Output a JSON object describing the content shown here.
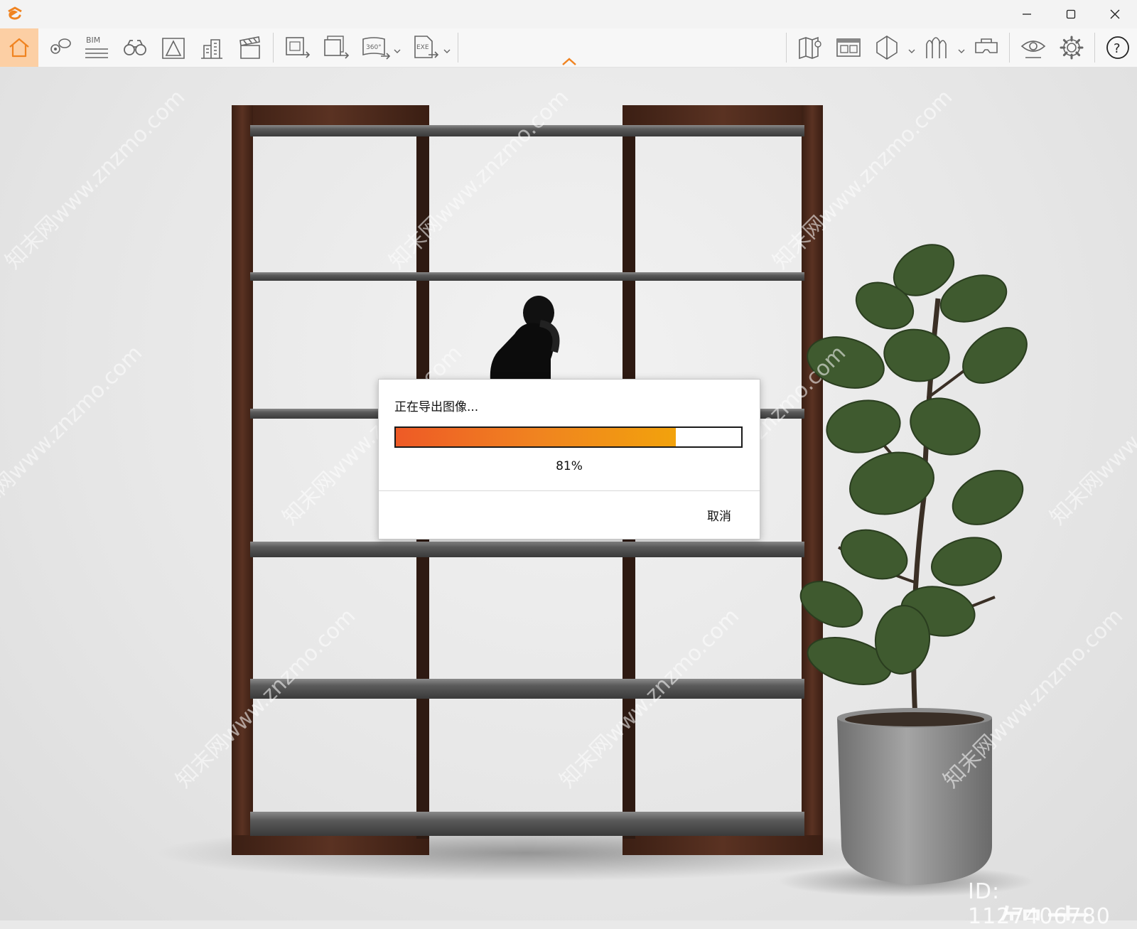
{
  "window": {
    "minimize_icon": "minimize-icon",
    "maximize_icon": "maximize-icon",
    "close_icon": "close-icon"
  },
  "toolbar": {
    "bim_label": "BIM",
    "pano_label": "360°",
    "exe_label": "EXE",
    "accent_color": "#f08320",
    "home_bg_color": "#fccfa4"
  },
  "export_dialog": {
    "title": "正在导出图像...",
    "progress": 0.81,
    "progress_text": "81%",
    "cancel_label": "取消"
  },
  "watermark": {
    "text": "知末网www.znzmo.com",
    "logo": "知末",
    "id_text": "ID: 1127406780"
  }
}
